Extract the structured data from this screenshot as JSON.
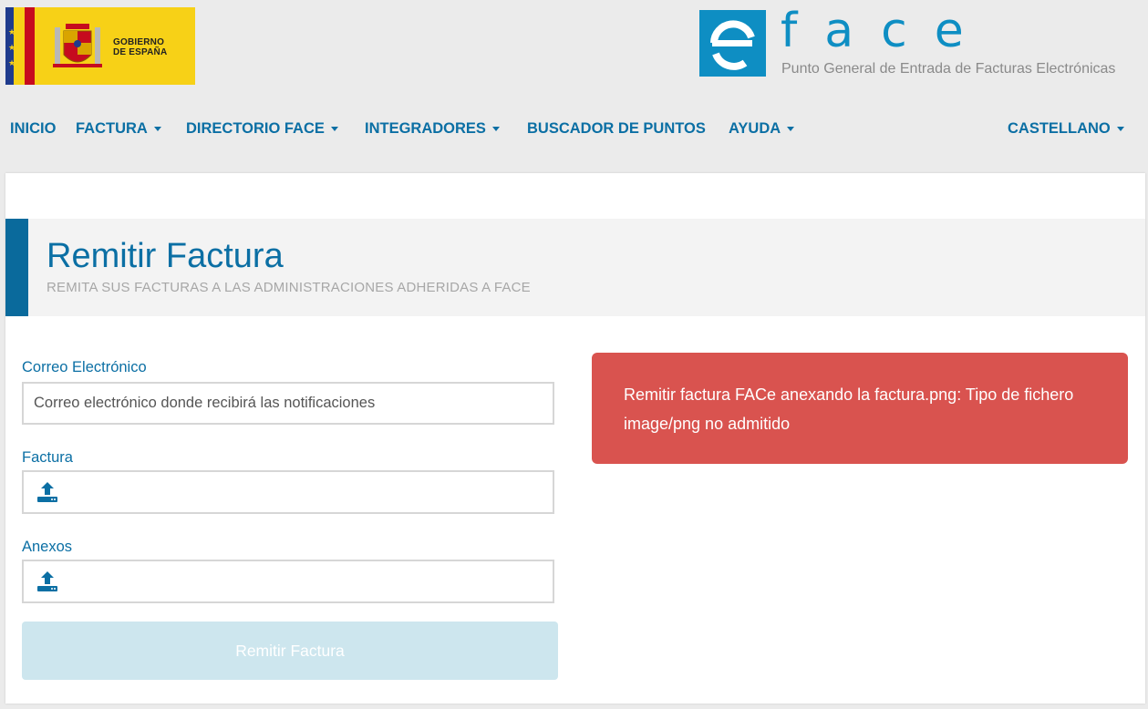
{
  "header": {
    "gov_logo_text_line1": "GOBIERNO",
    "gov_logo_text_line2": "DE ESPAÑA",
    "face_letters": "face",
    "face_subtitle": "Punto General de Entrada de Facturas Electrónicas"
  },
  "nav": {
    "items": [
      {
        "label": "INICIO",
        "dropdown": false
      },
      {
        "label": "FACTURA",
        "dropdown": true
      },
      {
        "label": "DIRECTORIO FACE",
        "dropdown": true
      },
      {
        "label": "INTEGRADORES",
        "dropdown": true
      },
      {
        "label": "BUSCADOR DE PUNTOS",
        "dropdown": false
      },
      {
        "label": "AYUDA",
        "dropdown": true
      }
    ],
    "language": {
      "label": "CASTELLANO",
      "dropdown": true
    }
  },
  "page": {
    "title": "Remitir Factura",
    "subtitle": "REMITA SUS FACTURAS A LAS ADMINISTRACIONES ADHERIDAS A FACE"
  },
  "form": {
    "email_label": "Correo Electrónico",
    "email_placeholder": "Correo electrónico donde recibirá las notificaciones",
    "email_value": "",
    "invoice_label": "Factura",
    "attachments_label": "Anexos",
    "submit_label": "Remitir Factura",
    "upload_icon": "upload-icon"
  },
  "alert": {
    "message": "Remitir factura FACe anexando la factura.png: Tipo de fichero image/png no admitido"
  },
  "colors": {
    "primary": "#0b6fa4",
    "face_blue": "#0e8ec3",
    "alert_red": "#d9534f",
    "submit_disabled": "#cde6ee",
    "background": "#ebebeb"
  }
}
